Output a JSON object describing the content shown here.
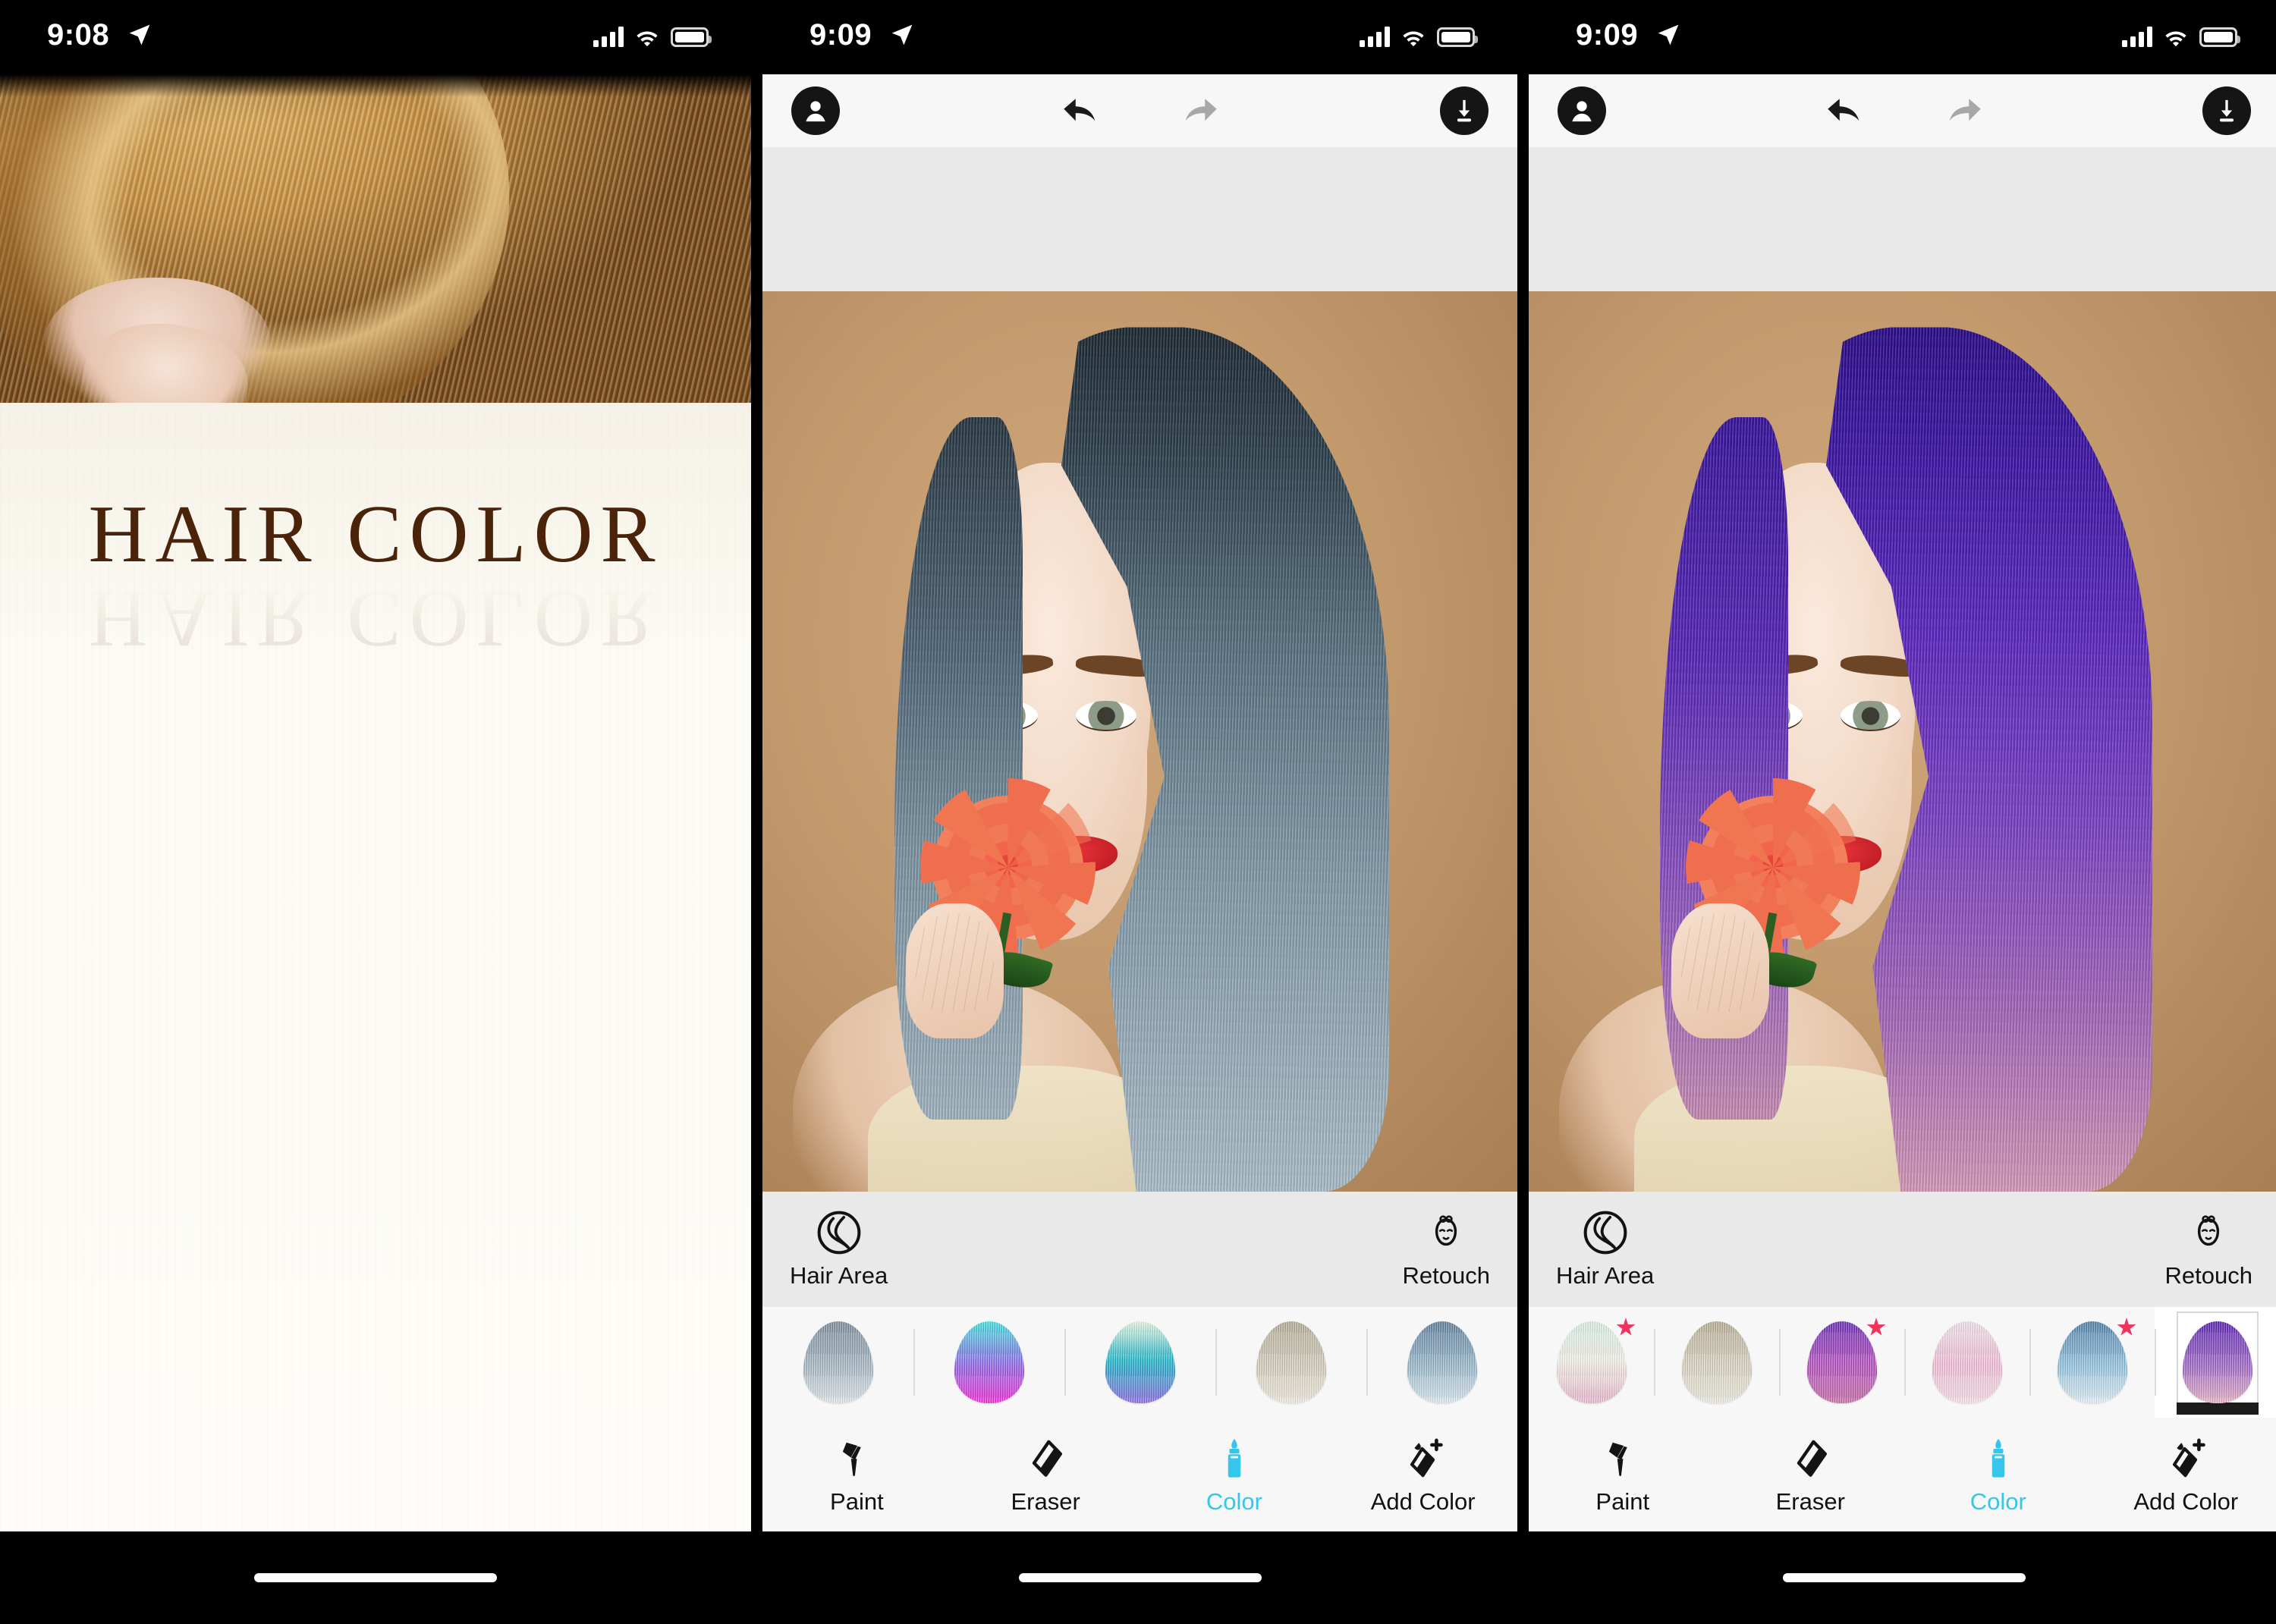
{
  "app": {
    "name": "Hair Color",
    "accent": "#35c6ec",
    "star_color": "#f0325c"
  },
  "panels": [
    {
      "id": "splash",
      "status": {
        "time": "9:08",
        "location_icon": "location-arrow-icon",
        "signal_icon": "cellular-signal-icon",
        "wifi_icon": "wifi-icon",
        "battery_icon": "battery-icon"
      },
      "brand_title": "HAIR COLOR",
      "brand_reflection": "HAIR COLOR"
    },
    {
      "id": "editor-blue",
      "status": {
        "time": "9:09",
        "location_icon": "location-arrow-icon",
        "signal_icon": "cellular-signal-icon",
        "wifi_icon": "wifi-icon",
        "battery_icon": "battery-icon"
      },
      "topbar": {
        "portrait_label": "portrait-icon",
        "undo_label": "undo-icon",
        "redo_label": "redo-icon",
        "save_label": "download-icon",
        "undo_enabled": "true",
        "redo_enabled": "false"
      },
      "hairbar": {
        "hair_area_label": "Hair Area",
        "retouch_label": "Retouch"
      },
      "swatches": [
        {
          "name": "steel-grey-blue",
          "top": "#7b8d9c",
          "mid": "#9fb0bc",
          "bottom": "#dfe6ea",
          "star": false,
          "selected": false
        },
        {
          "name": "cyan-magenta",
          "top": "#3fe4e0",
          "mid": "#8a6ae6",
          "bottom": "#f22ad8",
          "star": false,
          "selected": false
        },
        {
          "name": "mint-teal-violet",
          "top": "#eaf7e2",
          "mid": "#19b6c8",
          "bottom": "#8e6ae0",
          "star": false,
          "selected": false
        },
        {
          "name": "ash-beige",
          "top": "#b5ac96",
          "mid": "#cfc8b6",
          "bottom": "#efeade",
          "star": false,
          "selected": false
        },
        {
          "name": "denim-blue",
          "top": "#5f7f9c",
          "mid": "#8fb0c6",
          "bottom": "#dbe8ef",
          "star": false,
          "selected": false
        }
      ],
      "tools": [
        {
          "label": "Paint",
          "icon": "paint-brush-icon",
          "active": false
        },
        {
          "label": "Eraser",
          "icon": "eraser-icon",
          "active": false
        },
        {
          "label": "Color",
          "icon": "color-tube-icon",
          "active": true
        },
        {
          "label": "Add Color",
          "icon": "add-color-icon",
          "active": false
        }
      ],
      "photo": {
        "subject": "woman-holding-rose",
        "hair_color_top": "#2b3a46",
        "hair_color_mid": "#6d8494",
        "hair_color_bottom": "#9db2bf",
        "background": "#c39a6d",
        "lip_color": "#c51f27",
        "rose_color": "#ef6e4d"
      }
    },
    {
      "id": "editor-purple",
      "status": {
        "time": "9:09",
        "location_icon": "location-arrow-icon",
        "signal_icon": "cellular-signal-icon",
        "wifi_icon": "wifi-icon",
        "battery_icon": "battery-icon"
      },
      "topbar": {
        "portrait_label": "portrait-icon",
        "undo_label": "undo-icon",
        "redo_label": "redo-icon",
        "save_label": "download-icon",
        "undo_enabled": "true",
        "redo_enabled": "false"
      },
      "hairbar": {
        "hair_area_label": "Hair Area",
        "retouch_label": "Retouch"
      },
      "swatches": [
        {
          "name": "pale-mint-pink",
          "top": "#d9efe4",
          "mid": "#f3efe6",
          "bottom": "#e7b6cf",
          "star": true,
          "selected": false
        },
        {
          "name": "warm-ash-blonde",
          "top": "#b8ad95",
          "mid": "#d6cfbd",
          "bottom": "#eceadf",
          "star": false,
          "selected": false
        },
        {
          "name": "violet-magenta",
          "top": "#6a2bb5",
          "mid": "#b14bc0",
          "bottom": "#c86fa8",
          "star": true,
          "selected": false
        },
        {
          "name": "soft-pink",
          "top": "#f0e3ea",
          "mid": "#f0bcd6",
          "bottom": "#f6dfe8",
          "star": false,
          "selected": false
        },
        {
          "name": "sky-blue-fade",
          "top": "#4e7fa8",
          "mid": "#8fc0dc",
          "bottom": "#e2eff6",
          "star": true,
          "selected": false
        },
        {
          "name": "purple-pink-ombre",
          "top": "#5a21b0",
          "mid": "#9b63c6",
          "bottom": "#e7b3c6",
          "star": false,
          "selected": true
        }
      ],
      "tools": [
        {
          "label": "Paint",
          "icon": "paint-brush-icon",
          "active": false
        },
        {
          "label": "Eraser",
          "icon": "eraser-icon",
          "active": false
        },
        {
          "label": "Color",
          "icon": "color-tube-icon",
          "active": true
        },
        {
          "label": "Add Color",
          "icon": "add-color-icon",
          "active": false
        }
      ],
      "photo": {
        "subject": "woman-holding-rose",
        "hair_color_top": "#3a17a0",
        "hair_color_mid": "#6a2fc4",
        "hair_color_bottom": "#c77fb0",
        "background": "#c39a6d",
        "lip_color": "#c51f27",
        "rose_color": "#ef6e4d"
      }
    }
  ]
}
